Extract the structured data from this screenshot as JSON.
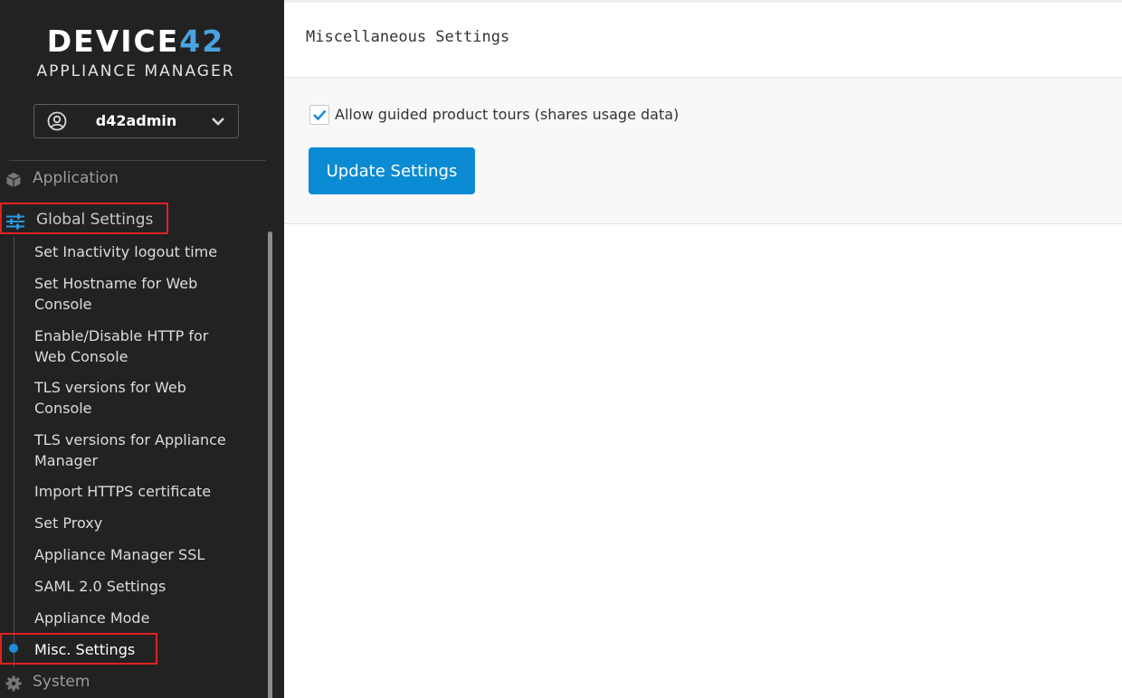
{
  "brand": {
    "logo_main": "DEVICE",
    "logo_accent": "42",
    "subtitle": "APPLIANCE MANAGER"
  },
  "user": {
    "name": "d42admin"
  },
  "nav": {
    "application": "Application",
    "global_settings": "Global Settings",
    "sub_items": [
      "Set Inactivity logout time",
      "Set Hostname for Web Console",
      "Enable/Disable HTTP for Web Console",
      "TLS versions for Web Console",
      "TLS versions for Appliance Manager",
      "Import HTTPS certificate",
      "Set Proxy",
      "Appliance Manager SSL",
      "SAML 2.0 Settings",
      "Appliance Mode",
      "Misc. Settings"
    ],
    "system": "System"
  },
  "page": {
    "title": "Miscellaneous Settings"
  },
  "form": {
    "tours_checked": true,
    "tours_label": "Allow guided product tours (shares usage data)",
    "update_button": "Update Settings"
  },
  "colors": {
    "accent": "#0b8bd3",
    "sidebar_bg": "#222222",
    "highlight_border": "#e02222"
  },
  "icons": {
    "user": "user-circle-icon",
    "chevron": "chevron-down-icon",
    "application": "cube-icon",
    "global_settings": "sliders-icon",
    "system": "gear-icon",
    "check": "checkmark-icon"
  }
}
